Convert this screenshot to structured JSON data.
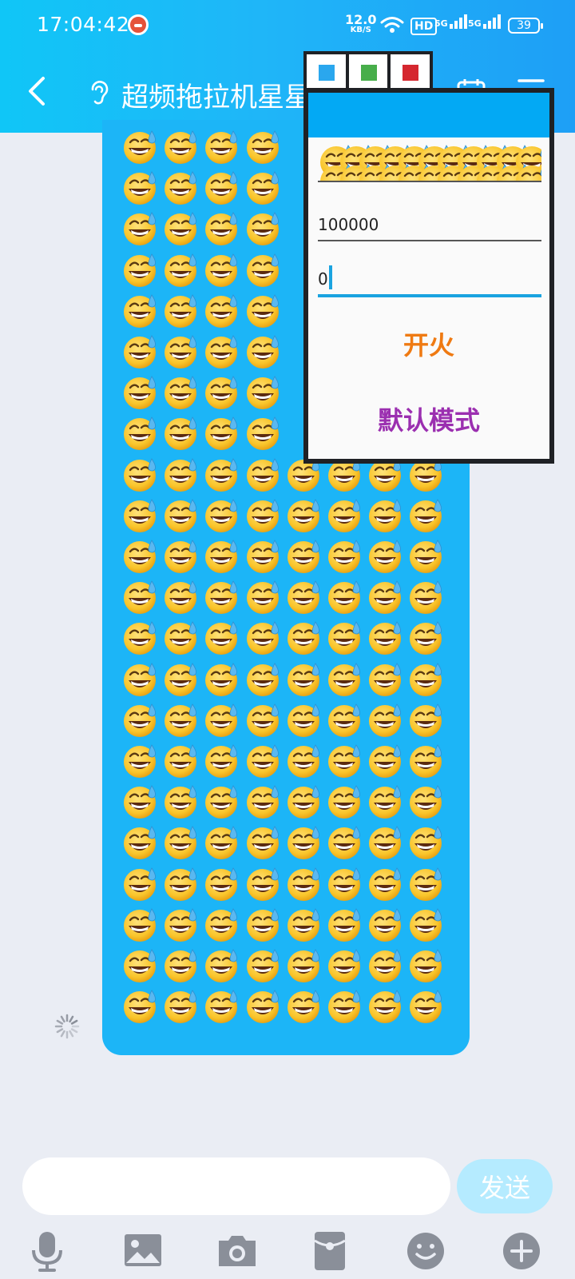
{
  "status_bar": {
    "time": "17:04:42",
    "net_speed_value": "12.0",
    "net_speed_unit": "KB/S",
    "hd_label": "HD",
    "sim1": "5G",
    "sim2": "5G",
    "battery": "39"
  },
  "header": {
    "title": "超频拖拉机星星"
  },
  "chat": {
    "message_emoji": "😅",
    "grid_columns": 8,
    "grid_rows": 22,
    "visible_columns_top_rows": 4,
    "covered_rows": 8
  },
  "overlay": {
    "tabs": [
      {
        "name": "blue-tab",
        "color": "#2aa7ee"
      },
      {
        "name": "green-tab",
        "color": "#47ae4a"
      },
      {
        "name": "red-tab",
        "color": "#d5272f"
      }
    ],
    "header_color": "#03a9f4",
    "emoji_field_count": 22,
    "count_value": "100000",
    "interval_value": "0",
    "fire_label": "开火",
    "mode_label": "默认模式"
  },
  "composer": {
    "input_value": "",
    "send_label": "发送"
  },
  "toolbar_icons": [
    "microphone-icon",
    "image-icon",
    "camera-icon",
    "red-packet-icon",
    "emoji-face-icon",
    "plus-icon"
  ],
  "colors": {
    "accent": "#1cb5f7",
    "background": "#eaedf4",
    "fire": "#ef7a12",
    "mode": "#9b2fb0",
    "toolbar_icon": "#8a8f99"
  }
}
